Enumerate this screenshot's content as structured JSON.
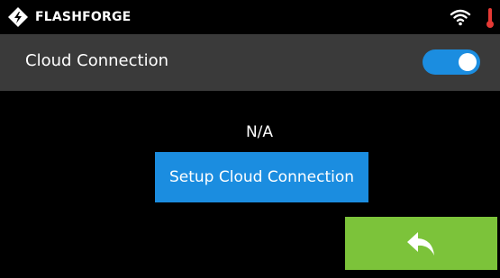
{
  "statusbar": {
    "brand_name": "FLASHFORGE",
    "logo_icon": "flashforge-logo-icon",
    "wifi_icon": "wifi-icon",
    "temperature_icon": "thermometer-icon"
  },
  "cloud_row": {
    "label": "Cloud Connection",
    "toggle_on": true
  },
  "main": {
    "status_text": "N/A",
    "setup_button_label": "Setup Cloud Connection",
    "back_icon": "back-arrow-icon"
  },
  "colors": {
    "background": "#000000",
    "row_background": "#3a3a3a",
    "accent_blue": "#1b8de0",
    "back_green": "#7cc33a",
    "thermo_red": "#e53935"
  }
}
